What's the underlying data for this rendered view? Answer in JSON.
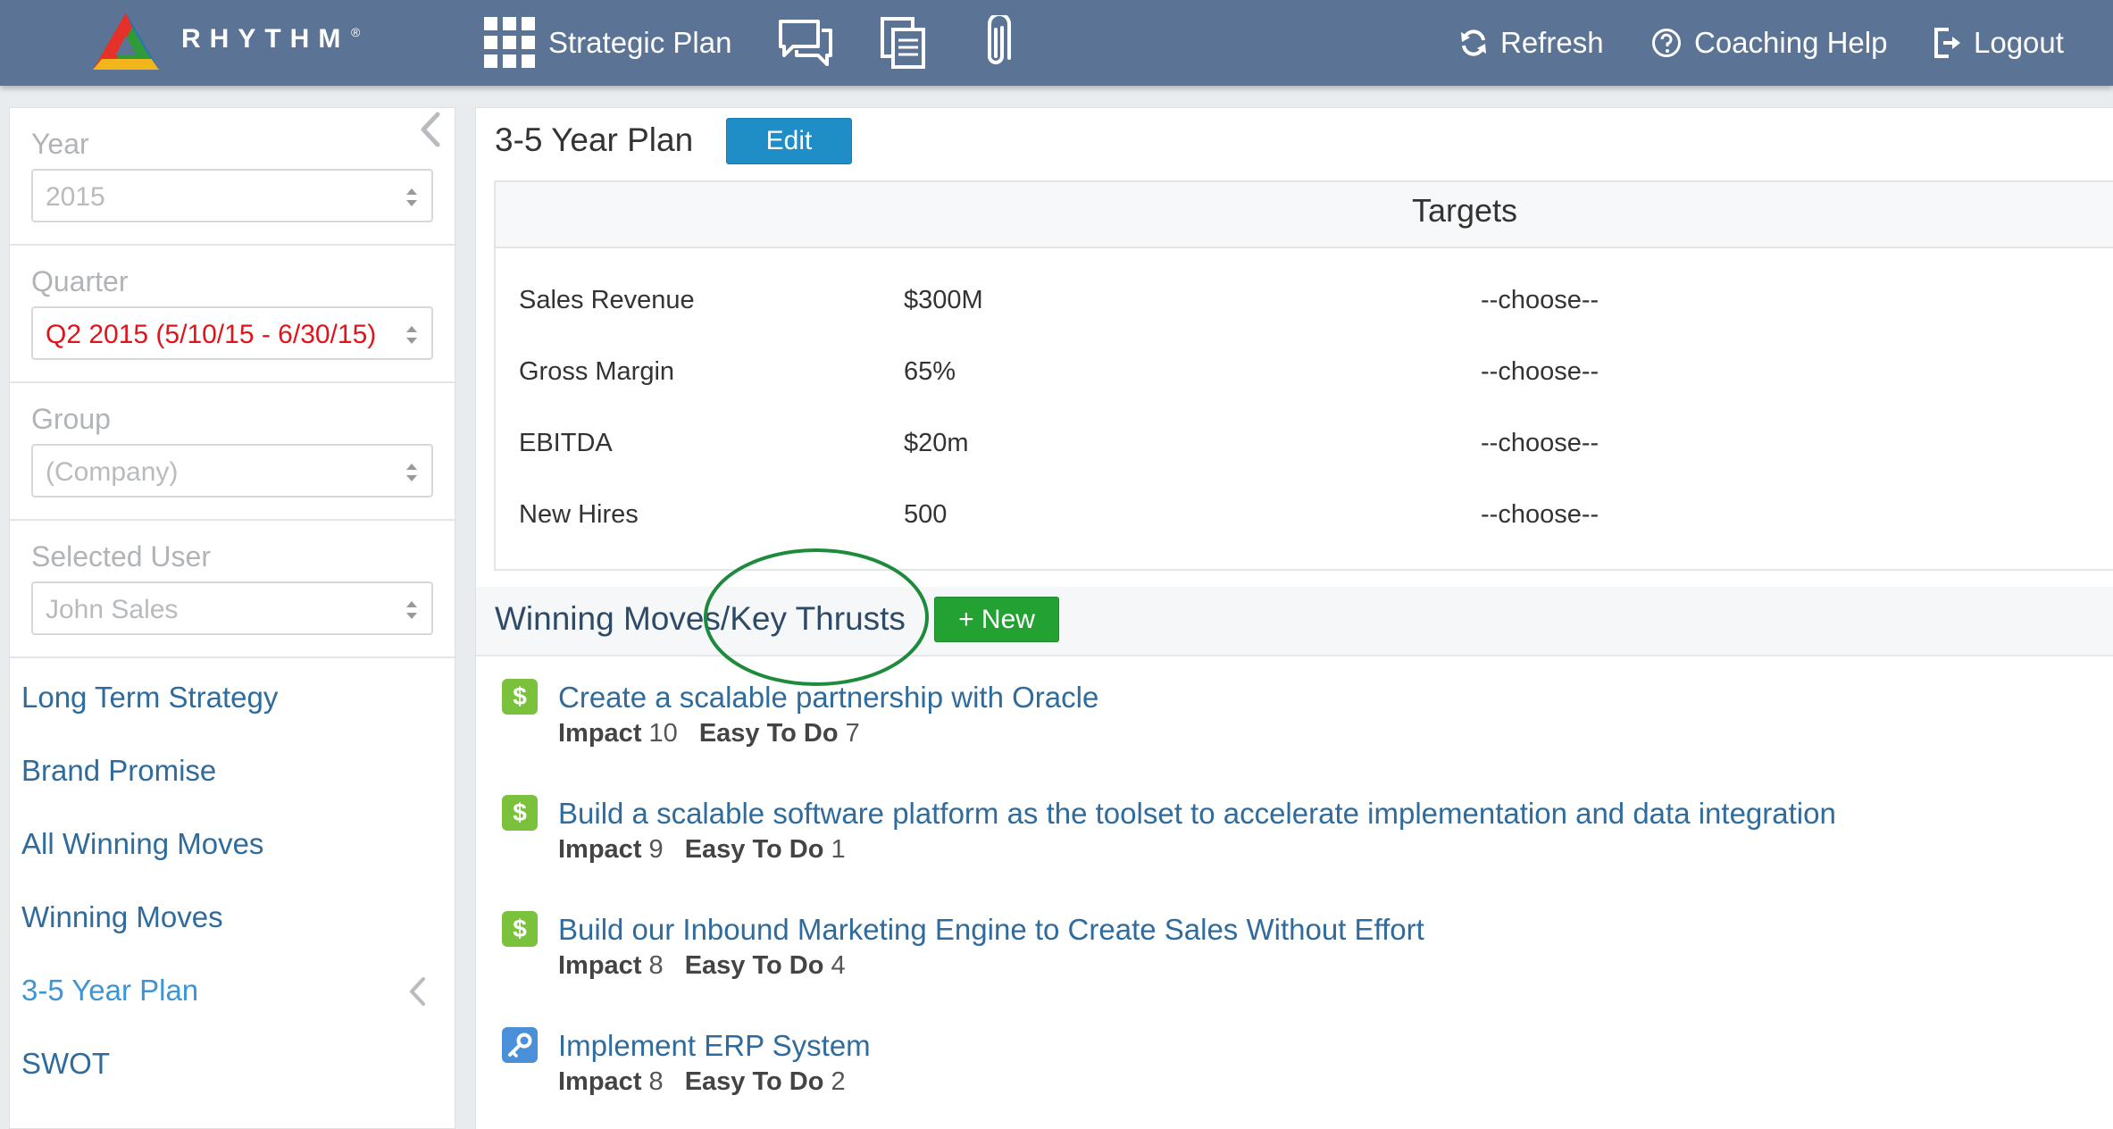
{
  "brand": {
    "name": "RHYTHM",
    "reg": "®"
  },
  "nav": {
    "strategic_plan": "Strategic Plan",
    "refresh": "Refresh",
    "coaching_help": "Coaching Help",
    "logout": "Logout"
  },
  "sidebar": {
    "filters": [
      {
        "label": "Year",
        "value": "2015"
      },
      {
        "label": "Quarter",
        "value": "Q2 2015 (5/10/15 - 6/30/15)"
      },
      {
        "label": "Group",
        "value": "(Company)"
      },
      {
        "label": "Selected User",
        "value": "John Sales"
      }
    ],
    "links": [
      {
        "label": "Long Term Strategy",
        "active": false
      },
      {
        "label": "Brand Promise",
        "active": false
      },
      {
        "label": "All Winning Moves",
        "active": false
      },
      {
        "label": "Winning Moves",
        "active": false
      },
      {
        "label": "3-5 Year Plan",
        "active": true
      },
      {
        "label": "SWOT",
        "active": false
      }
    ]
  },
  "main": {
    "title": "3-5 Year Plan",
    "edit_label": "Edit",
    "targets": {
      "title": "Targets",
      "rows": [
        {
          "name": "Sales Revenue",
          "value": "$300M",
          "choose": "--choose--"
        },
        {
          "name": "Gross Margin",
          "value": "65%",
          "choose": "--choose--"
        },
        {
          "name": "EBITDA",
          "value": "$20m",
          "choose": "--choose--"
        },
        {
          "name": "New Hires",
          "value": "500",
          "choose": "--choose--"
        }
      ]
    },
    "winning_moves": {
      "title": "Winning Moves/Key Thrusts",
      "new_label": "+ New",
      "impact_label": "Impact",
      "easy_label": "Easy To Do",
      "items": [
        {
          "icon": "dollar-icon",
          "title": "Create a scalable partnership with Oracle",
          "impact": "10",
          "easy": "7"
        },
        {
          "icon": "dollar-icon",
          "title": "Build a scalable software platform as the toolset to accelerate implementation and data integration",
          "impact": "9",
          "easy": "1"
        },
        {
          "icon": "dollar-icon",
          "title": "Build our Inbound Marketing Engine to Create Sales Without Effort",
          "impact": "8",
          "easy": "4"
        },
        {
          "icon": "key-icon",
          "title": "Implement ERP System",
          "impact": "8",
          "easy": "2"
        }
      ]
    }
  },
  "colors": {
    "navbar": "#5b7495",
    "link": "#2f6b9c",
    "active_link": "#3d95d6",
    "edit_button": "#1f8dc6",
    "new_button": "#23a133",
    "quarter_text": "#e0141b",
    "annotation_circle": "#1e8a3c"
  }
}
